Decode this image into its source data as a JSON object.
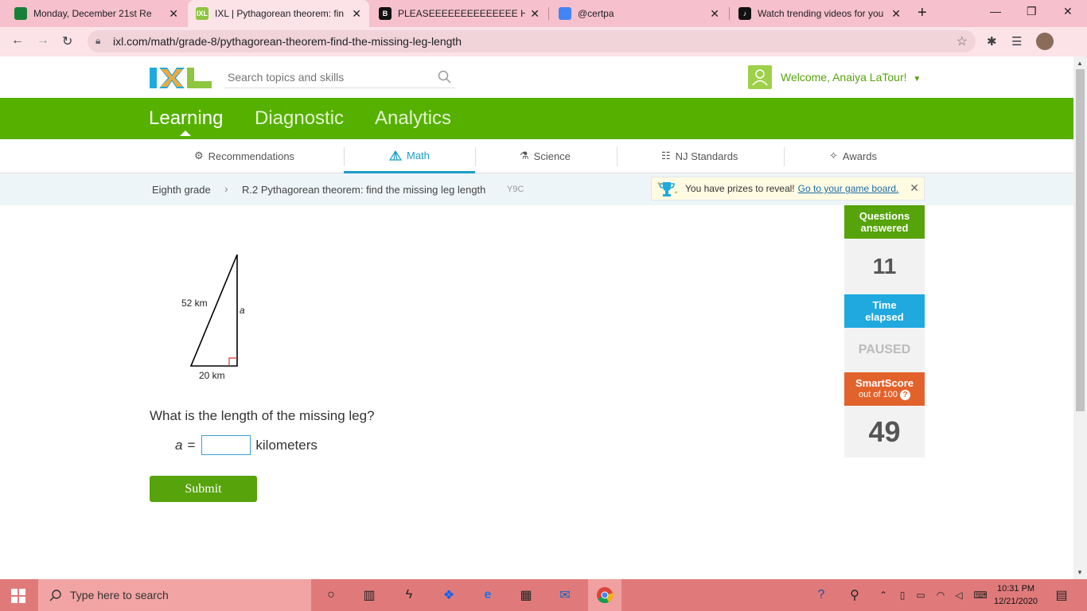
{
  "browser": {
    "tabs": [
      {
        "title": "Monday, December 21st Re",
        "favicon_color": "#188038"
      },
      {
        "title": "IXL | Pythagorean theorem: fin",
        "favicon_color": "#8dc63f"
      },
      {
        "title": "PLEASEEEEEEEEEEEEEE HELP -",
        "favicon_color": "#111111"
      },
      {
        "title": "@certpa",
        "favicon_color": "#4285f4"
      },
      {
        "title": "Watch trending videos for you",
        "favicon_color": "#111111"
      }
    ],
    "url": "ixl.com/math/grade-8/pythagorean-theorem-find-the-missing-leg-length"
  },
  "header": {
    "search_placeholder": "Search topics and skills",
    "welcome": "Welcome, Anaiya LaTour!"
  },
  "main_nav": [
    "Learning",
    "Diagnostic",
    "Analytics"
  ],
  "sub_nav": [
    "Recommendations",
    "Math",
    "Science",
    "NJ Standards",
    "Awards"
  ],
  "breadcrumb": {
    "grade": "Eighth grade",
    "skill": "R.2 Pythagorean theorem: find the missing leg length",
    "code": "Y9C"
  },
  "prize": {
    "text": "You have prizes to reveal!",
    "link": "Go to your game board."
  },
  "problem": {
    "hypotenuse_label": "52 km",
    "base_label": "20 km",
    "leg_label": "a",
    "question": "What is the length of the missing leg?",
    "var": "a",
    "equals": "=",
    "unit": "kilometers",
    "submit": "Submit"
  },
  "stats": {
    "questions_label": "Questions answered",
    "questions_value": "11",
    "time_label": "Time elapsed",
    "time_value": "PAUSED",
    "smartscore_label": "SmartScore",
    "smartscore_sub": "out of 100",
    "smartscore_value": "49"
  },
  "taskbar": {
    "search_placeholder": "Type here to search",
    "time": "10:31 PM",
    "date": "12/21/2020"
  },
  "colors": {
    "ixl_green": "#56b000",
    "math_blue": "#1a9ec6",
    "stat_green": "#56a30c",
    "stat_blue": "#1fa9df",
    "stat_orange": "#e2622b"
  }
}
